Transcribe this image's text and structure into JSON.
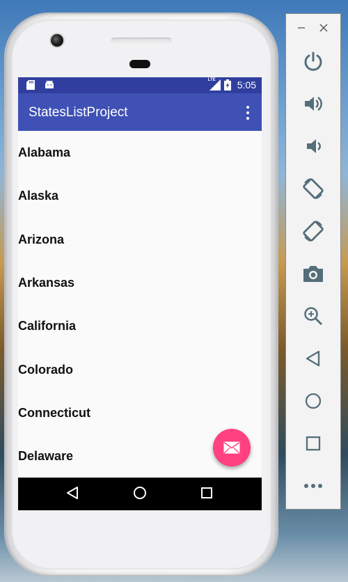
{
  "app": {
    "title": "StatesListProject"
  },
  "status_bar": {
    "time": "5:05",
    "network": "LTE"
  },
  "states": [
    "Alabama",
    "Alaska",
    "Arizona",
    "Arkansas",
    "California",
    "Colorado",
    "Connecticut",
    "Delaware"
  ],
  "colors": {
    "primary": "#3f51b5",
    "primary_dark": "#303f9f",
    "accent": "#ff4081",
    "icon_gray": "#546e7a"
  },
  "icons": {
    "fab": "email-icon",
    "overflow": "more-vert-icon",
    "nav": [
      "back-icon",
      "home-icon",
      "recents-icon"
    ],
    "emulator_tools": [
      "power-icon",
      "volume-up-icon",
      "volume-down-icon",
      "rotate-left-icon",
      "rotate-right-icon",
      "camera-icon",
      "zoom-icon",
      "back-icon",
      "home-icon",
      "overview-icon",
      "more-icon"
    ]
  }
}
